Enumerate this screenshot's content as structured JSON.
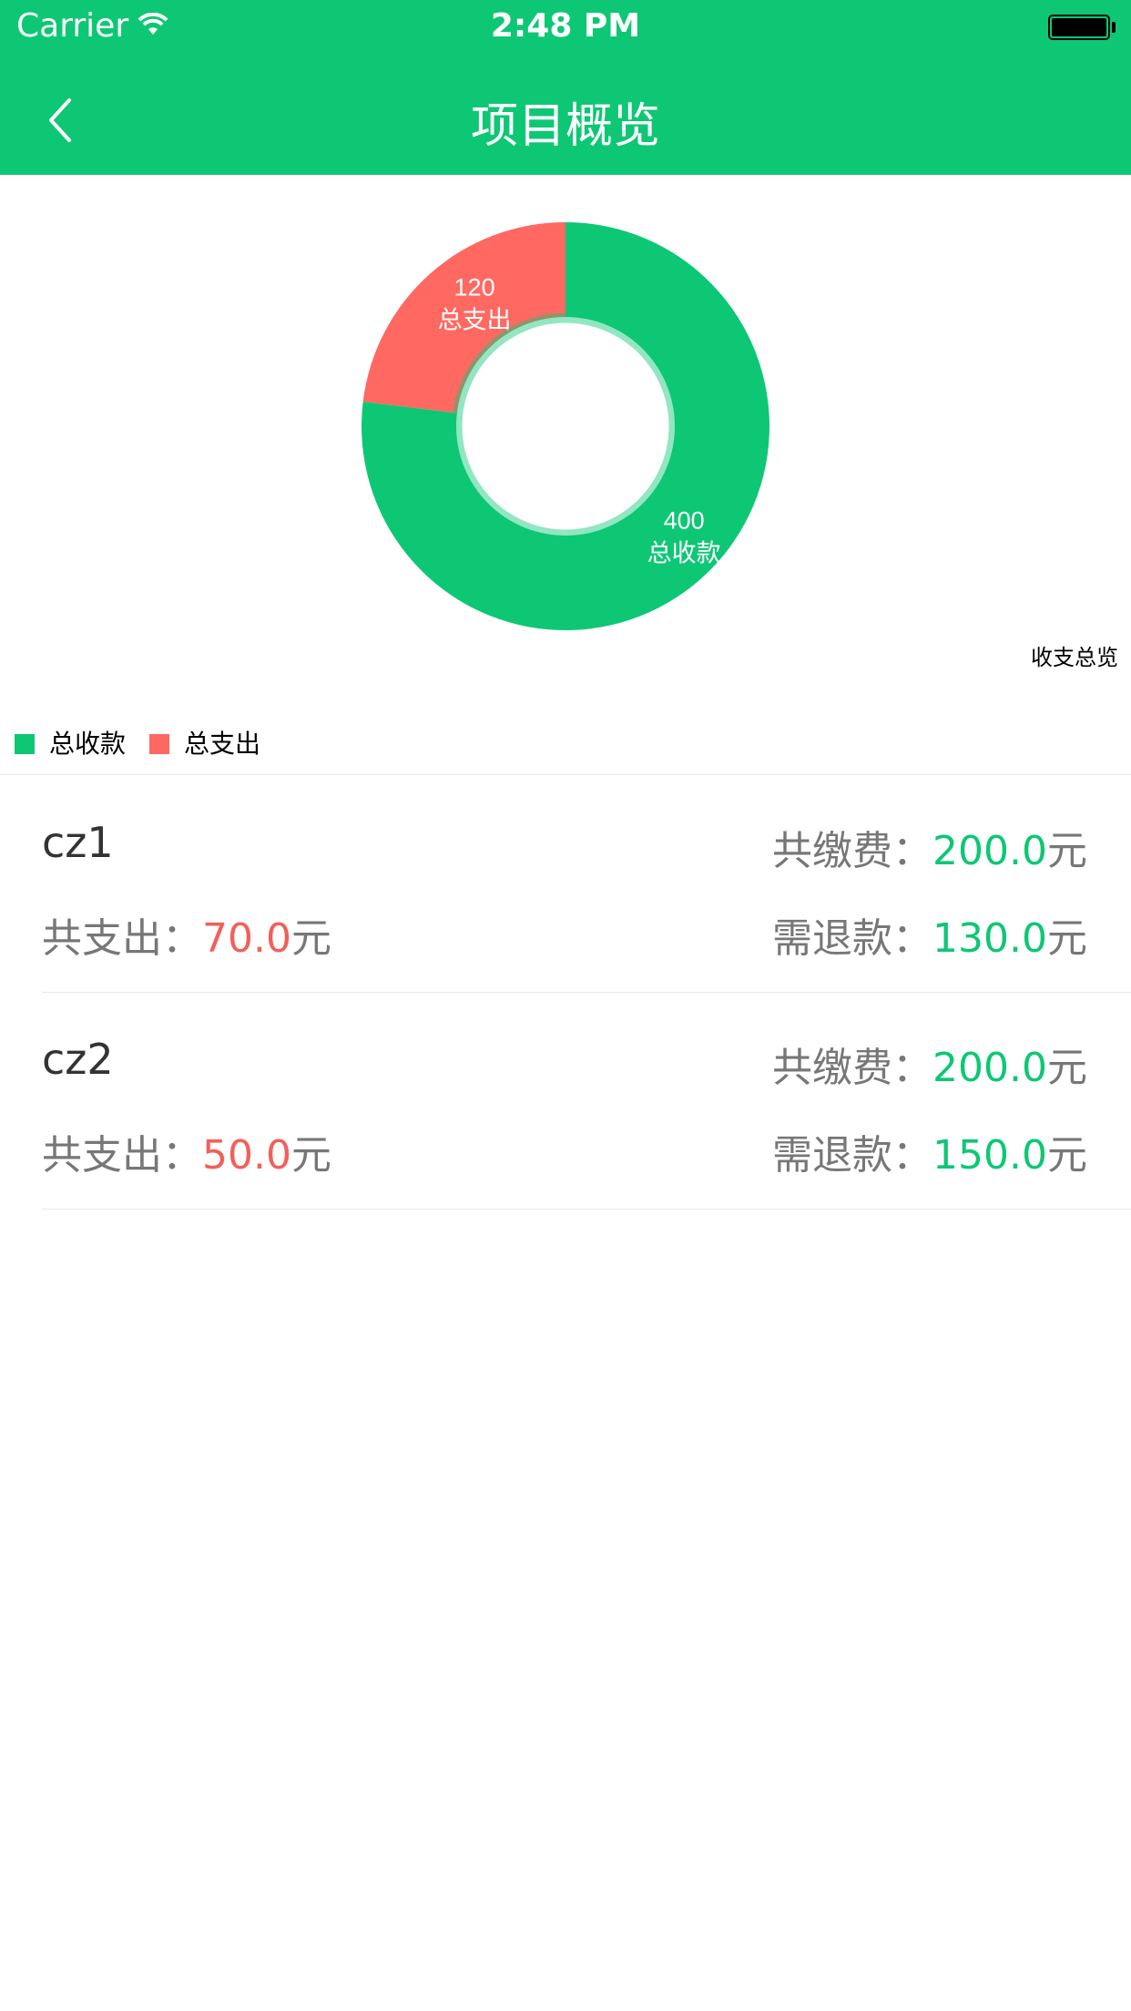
{
  "status_bar": {
    "carrier": "Carrier",
    "time": "2:48 PM"
  },
  "nav": {
    "back_icon": "chevron-left-icon",
    "title": "项目概览"
  },
  "colors": {
    "brand_green": "#0ec775",
    "expense_red": "#ff6961"
  },
  "chart_data": {
    "type": "pie",
    "style": "donut",
    "caption": "收支总览",
    "slices": [
      {
        "label": "总收款",
        "value": 400,
        "color": "#0ec775"
      },
      {
        "label": "总支出",
        "value": 120,
        "color": "#ff6961"
      }
    ],
    "legend": {
      "position": "bottom-left",
      "entries": [
        "总收款",
        "总支出"
      ]
    }
  },
  "list": {
    "items": [
      {
        "name": "cz1",
        "paid_label": "共缴费：",
        "paid_value": "200.0",
        "spent_label": "共支出：",
        "spent_value": "70.0",
        "refund_label": "需退款：",
        "refund_value": "130.0",
        "unit": "元"
      },
      {
        "name": "cz2",
        "paid_label": "共缴费：",
        "paid_value": "200.0",
        "spent_label": "共支出：",
        "spent_value": "50.0",
        "refund_label": "需退款：",
        "refund_value": "150.0",
        "unit": "元"
      }
    ]
  }
}
